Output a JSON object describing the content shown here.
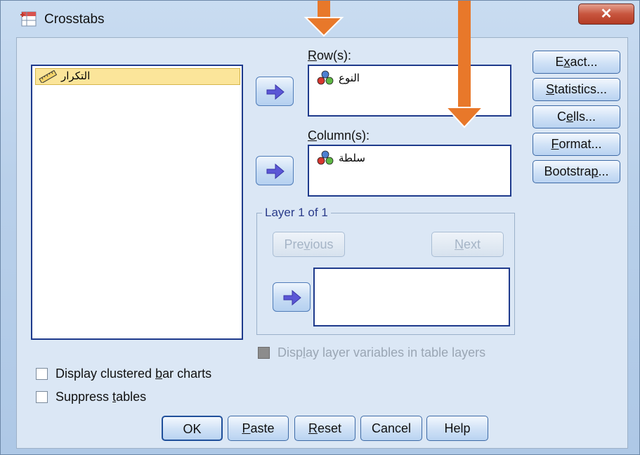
{
  "window": {
    "title": "Crosstabs",
    "close_glyph": "✕"
  },
  "variables": {
    "items": [
      {
        "label": "التكرار",
        "icon": "scale-ruler-icon"
      }
    ]
  },
  "rows": {
    "label_pre": "",
    "label_mnemonic": "R",
    "label_post": "ow(s):",
    "items": [
      {
        "label": "النوع",
        "icon": "nominal-variable-icon"
      }
    ]
  },
  "columns": {
    "label_pre": "",
    "label_mnemonic": "C",
    "label_post": "olumn(s):",
    "items": [
      {
        "label": "سلطة",
        "icon": "nominal-variable-icon"
      }
    ]
  },
  "side_buttons": [
    {
      "pre": "E",
      "m": "x",
      "post": "act..."
    },
    {
      "pre": "",
      "m": "S",
      "post": "tatistics..."
    },
    {
      "pre": "C",
      "m": "e",
      "post": "lls..."
    },
    {
      "pre": "",
      "m": "F",
      "post": "ormat..."
    },
    {
      "pre": "Bootstra",
      "m": "p",
      "post": "..."
    }
  ],
  "layer": {
    "title": "Layer 1 of 1",
    "previous": {
      "pre": "Pre",
      "m": "v",
      "post": "ious"
    },
    "next": {
      "pre": "",
      "m": "N",
      "post": "ext"
    }
  },
  "options": {
    "display_layer": {
      "pre": "Disp",
      "m": "l",
      "post": "ay layer variables in table layers",
      "checked": false,
      "enabled": false
    },
    "clustered": {
      "pre": "Display clustered ",
      "m": "b",
      "post": "ar charts",
      "checked": false
    },
    "suppress": {
      "pre": "Suppress ",
      "m": "t",
      "post": "ables",
      "checked": false
    }
  },
  "bottom_buttons": [
    {
      "pre": "OK",
      "m": "",
      "post": ""
    },
    {
      "pre": "",
      "m": "P",
      "post": "aste"
    },
    {
      "pre": "",
      "m": "R",
      "post": "eset"
    },
    {
      "pre": "Cancel",
      "m": "",
      "post": ""
    },
    {
      "pre": "Help",
      "m": "",
      "post": ""
    }
  ],
  "colors": {
    "annotation_arrow": "#e8782a",
    "list_border": "#1e3a8c",
    "selected_item": "#fbe59a"
  }
}
